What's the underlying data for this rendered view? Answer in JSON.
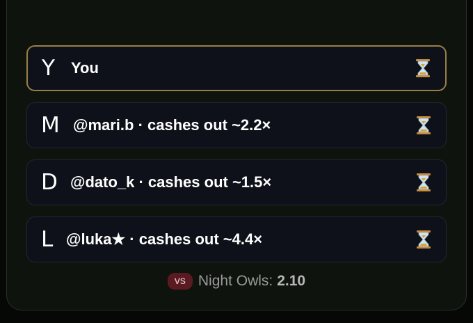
{
  "players": [
    {
      "initial": "Y",
      "label": "You",
      "status_icon": "hourglass-icon"
    },
    {
      "initial": "M",
      "label": "@mari.b · cashes out ~2.2×",
      "status_icon": "hourglass-icon"
    },
    {
      "initial": "D",
      "label": "@dato_k · cashes out ~1.5×",
      "status_icon": "hourglass-icon"
    },
    {
      "initial": "L",
      "label": "@luka★ · cashes out ~4.4×",
      "status_icon": "hourglass-icon"
    }
  ],
  "footer": {
    "vs_label": "vs",
    "opponent": "Night Owls:",
    "score": "2.10"
  },
  "colors": {
    "self_border": "#9a7f45",
    "vs_badge_bg": "#5a1a22",
    "hourglass": "#e0a030"
  }
}
